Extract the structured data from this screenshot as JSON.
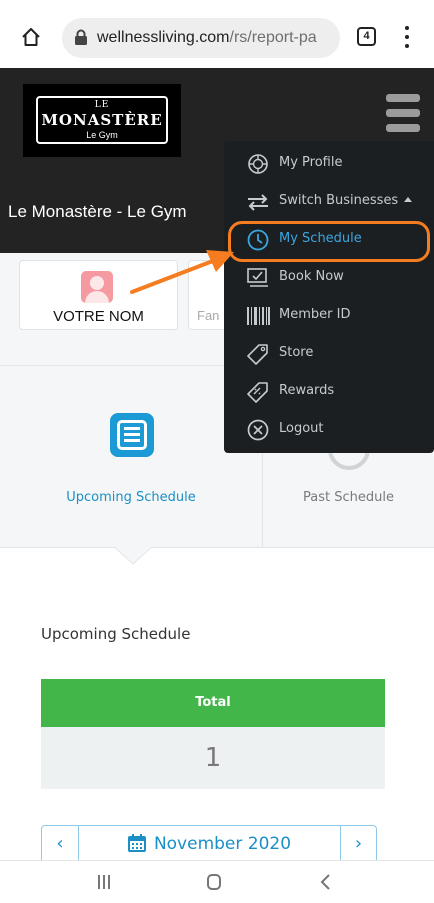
{
  "browser": {
    "url_host": "wellnessliving.com",
    "url_path": "/rs/report-pa",
    "tab_count": "4"
  },
  "header": {
    "logo": {
      "top": "LE",
      "name": "MONASTÈRE",
      "sub": "Le Gym"
    },
    "business_name": "Le Monastère - Le Gym"
  },
  "profile": {
    "name": "VOTRE NOM",
    "family_label": "Fan"
  },
  "schedule_tabs": {
    "upcoming_label": "Upcoming Schedule",
    "past_label": "Past Schedule"
  },
  "content": {
    "section_title": "Upcoming Schedule",
    "total_label": "Total",
    "total_value": "1",
    "month_label": "November 2020",
    "prev_label": "‹",
    "next_label": "›"
  },
  "menu": {
    "items": [
      {
        "label": "My Profile",
        "icon": "profile-icon"
      },
      {
        "label": "Switch Businesses",
        "icon": "switch-icon"
      },
      {
        "label": "My Schedule",
        "icon": "clock-icon",
        "active": true
      },
      {
        "label": "Book Now",
        "icon": "book-icon"
      },
      {
        "label": "Member ID",
        "icon": "barcode-icon"
      },
      {
        "label": "Store",
        "icon": "tag-icon"
      },
      {
        "label": "Rewards",
        "icon": "rewards-icon"
      },
      {
        "label": "Logout",
        "icon": "logout-icon"
      }
    ]
  },
  "colors": {
    "accent_blue": "#1b9ad6",
    "total_green": "#43b649",
    "highlight_orange": "#f57c1f",
    "menu_bg": "#1c1f21"
  }
}
